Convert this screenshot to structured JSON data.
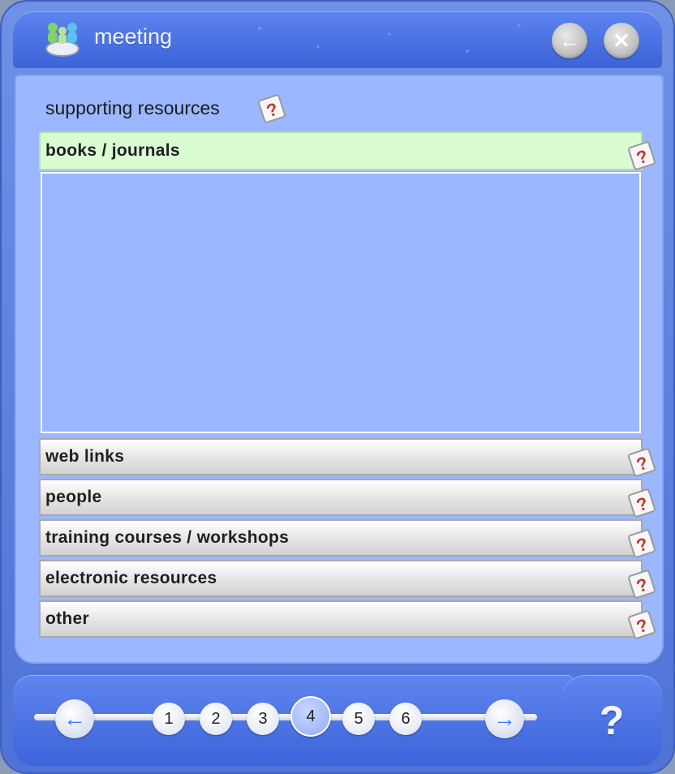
{
  "window": {
    "title": "meeting"
  },
  "title_buttons": {
    "back_symbol": "←",
    "close_symbol": "✕"
  },
  "section": {
    "label": "supporting resources"
  },
  "accordion": {
    "open_item": "books / journals",
    "items": [
      "web links",
      "people",
      "training courses / workshops",
      "electronic resources",
      "other"
    ]
  },
  "pagination": {
    "prev_symbol": "←",
    "next_symbol": "→",
    "pages": [
      "1",
      "2",
      "3",
      "4",
      "5",
      "6"
    ],
    "current_page": "4"
  },
  "help": {
    "big_label": "?"
  },
  "icons": {
    "title": "meeting-people-icon",
    "help_tag": "question-mark-tag-icon"
  },
  "colors": {
    "panel": "#9bb7ff",
    "open_item": "#d9fcd2",
    "titlebar": "#4f75e0"
  }
}
